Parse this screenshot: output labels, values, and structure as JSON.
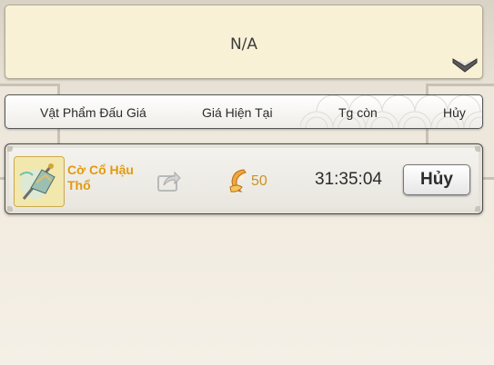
{
  "search": {
    "value": "N/A",
    "dropdown_icon": "chevron-down-icon"
  },
  "columns": {
    "item": "Vật Phẩm Đấu Giá",
    "price": "Giá Hiện Tại",
    "time": "Tg còn",
    "cancel": "Hủy"
  },
  "listing": {
    "item_name": "Cờ Cổ Hậu Thổ",
    "item_icon": "flag-banner-icon",
    "share_icon": "share-icon",
    "price_icon": "gold-ingot-icon",
    "price": "50",
    "time_left": "31:35:04",
    "cancel_label": "Hủy"
  },
  "colors": {
    "item_name": "#e39a0c",
    "price": "#c99325",
    "panel": "#f8f1d6"
  }
}
